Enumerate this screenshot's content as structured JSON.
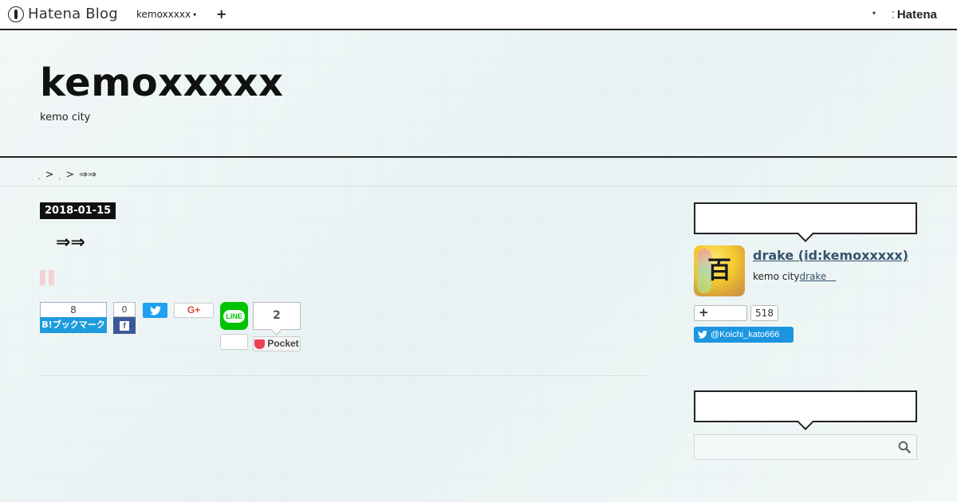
{
  "topbar": {
    "logo_text": "Hatena Blog",
    "blog_menu_label": "kemoxxxxx",
    "add_label": "+",
    "hatena_label": "Hatena"
  },
  "header": {
    "title": "kemoxxxxx",
    "description": "kemo city"
  },
  "breadcrumb": {
    "items": [
      "˻",
      "˻",
      "⇒⇒"
    ],
    "separator": ">"
  },
  "article": {
    "date": "2018-01-15",
    "title": "⇒⇒"
  },
  "share": {
    "hatena_bookmark": {
      "count": "8",
      "label": "B!ブックマーク"
    },
    "facebook": {
      "count": "0",
      "icon": "facebook-icon"
    },
    "twitter": {
      "icon": "twitter-icon"
    },
    "googleplus": {
      "label": "G+"
    },
    "line": {
      "label": "LINE"
    },
    "pocket": {
      "count": "2",
      "label": "Pocket"
    }
  },
  "sidebar": {
    "profile_heading": "",
    "author_name": "drake (id:kemoxxxxx)",
    "avatar_char": "百",
    "author_desc_text": "kemo city",
    "author_desc_link": "drake＿",
    "subscribe_label": "+",
    "subscribe_count": "518",
    "twitter_follow": "@Koichi_kato666",
    "search_heading": "",
    "search_placeholder": ""
  },
  "colors": {
    "hatena_blue": "#1d9bde",
    "facebook": "#3b5998",
    "twitter": "#1da1f2",
    "line": "#00c300",
    "pocket": "#ef4056",
    "link": "#35536e"
  }
}
